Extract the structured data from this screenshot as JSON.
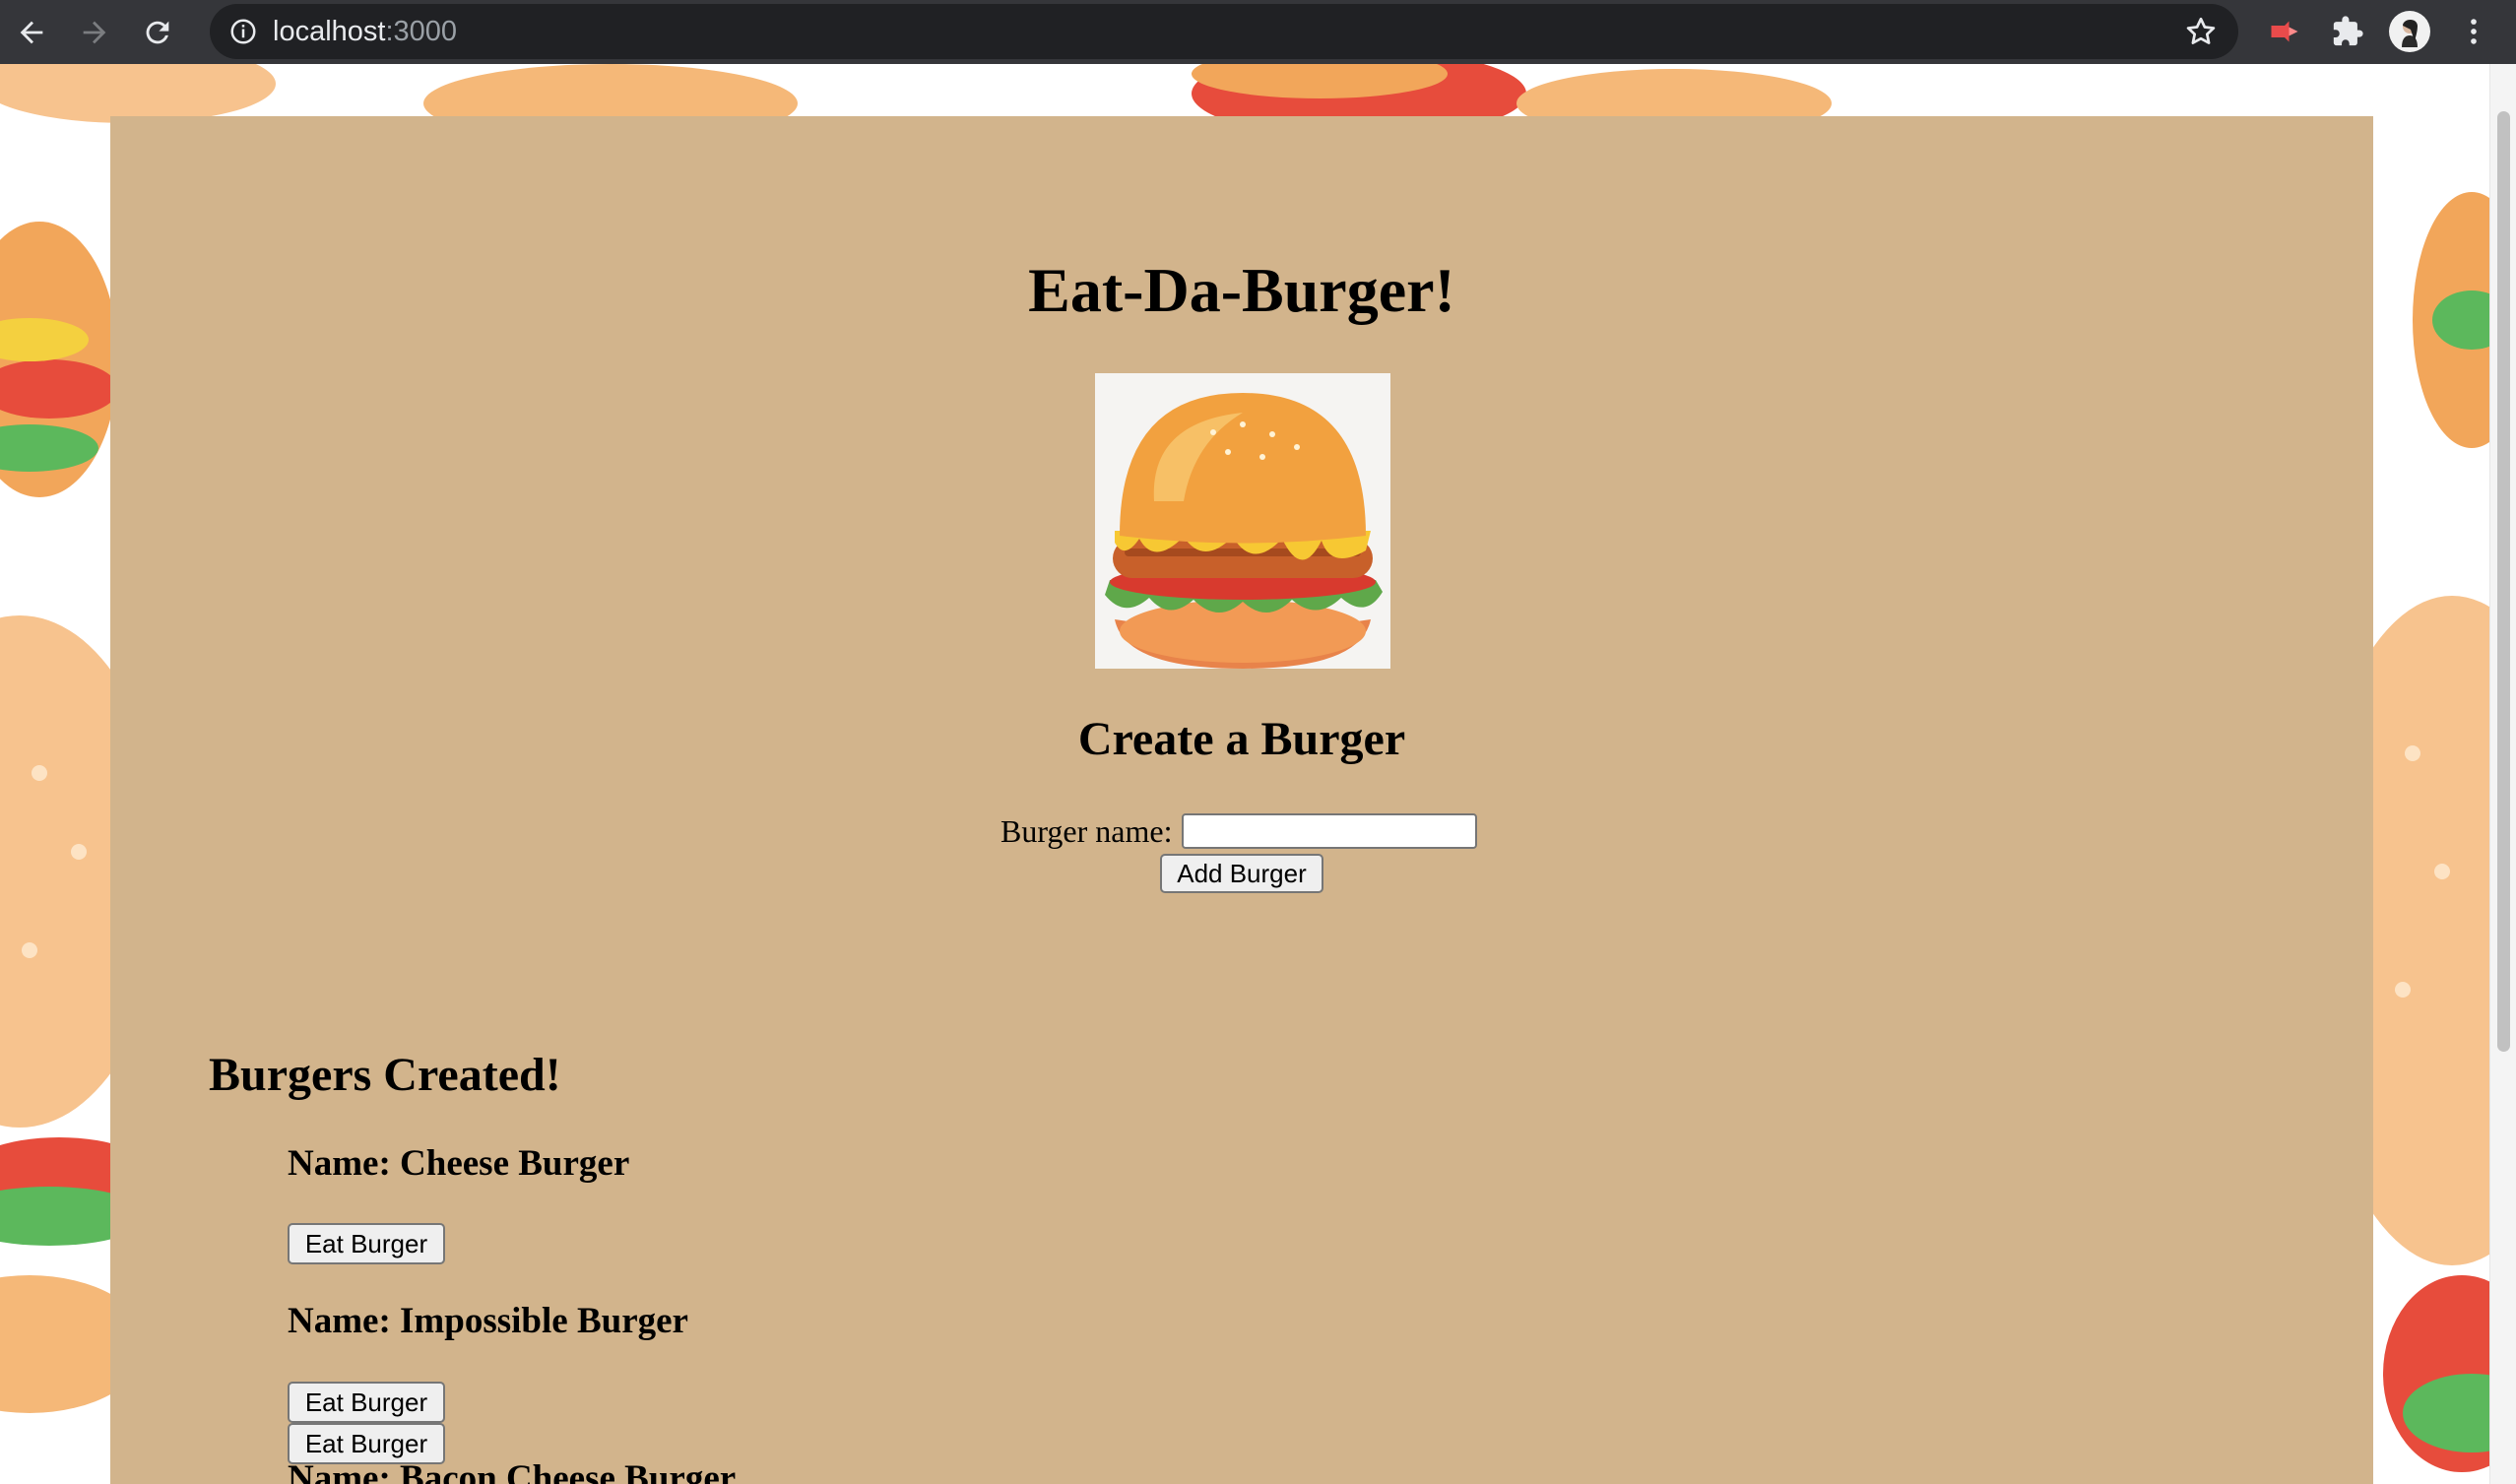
{
  "browser": {
    "url_host": "localhost",
    "url_port": ":3000"
  },
  "page": {
    "title": "Eat-Da-Burger!",
    "create_heading": "Create a Burger",
    "form": {
      "label": "Burger name:",
      "input_value": "",
      "submit_label": "Add Burger"
    },
    "list_heading": "Burgers Created!",
    "burgers": [
      {
        "name": "Name: Cheese Burger",
        "button": "Eat Burger"
      },
      {
        "name": "Name: Impossible Burger",
        "button": "Eat Burger"
      },
      {
        "name": "Name: Bacon Cheese Burger",
        "button": "Eat Burger"
      }
    ]
  },
  "colors": {
    "chrome_bg": "#35363a",
    "omnibox_bg": "#202124",
    "container_bg": "#d2b48c",
    "button_bg": "#efefef"
  },
  "icons": [
    "back-icon",
    "forward-icon",
    "reload-icon",
    "info-icon",
    "star-icon",
    "extension-icon",
    "puzzle-icon",
    "avatar",
    "more-menu-icon",
    "burger-logo"
  ]
}
